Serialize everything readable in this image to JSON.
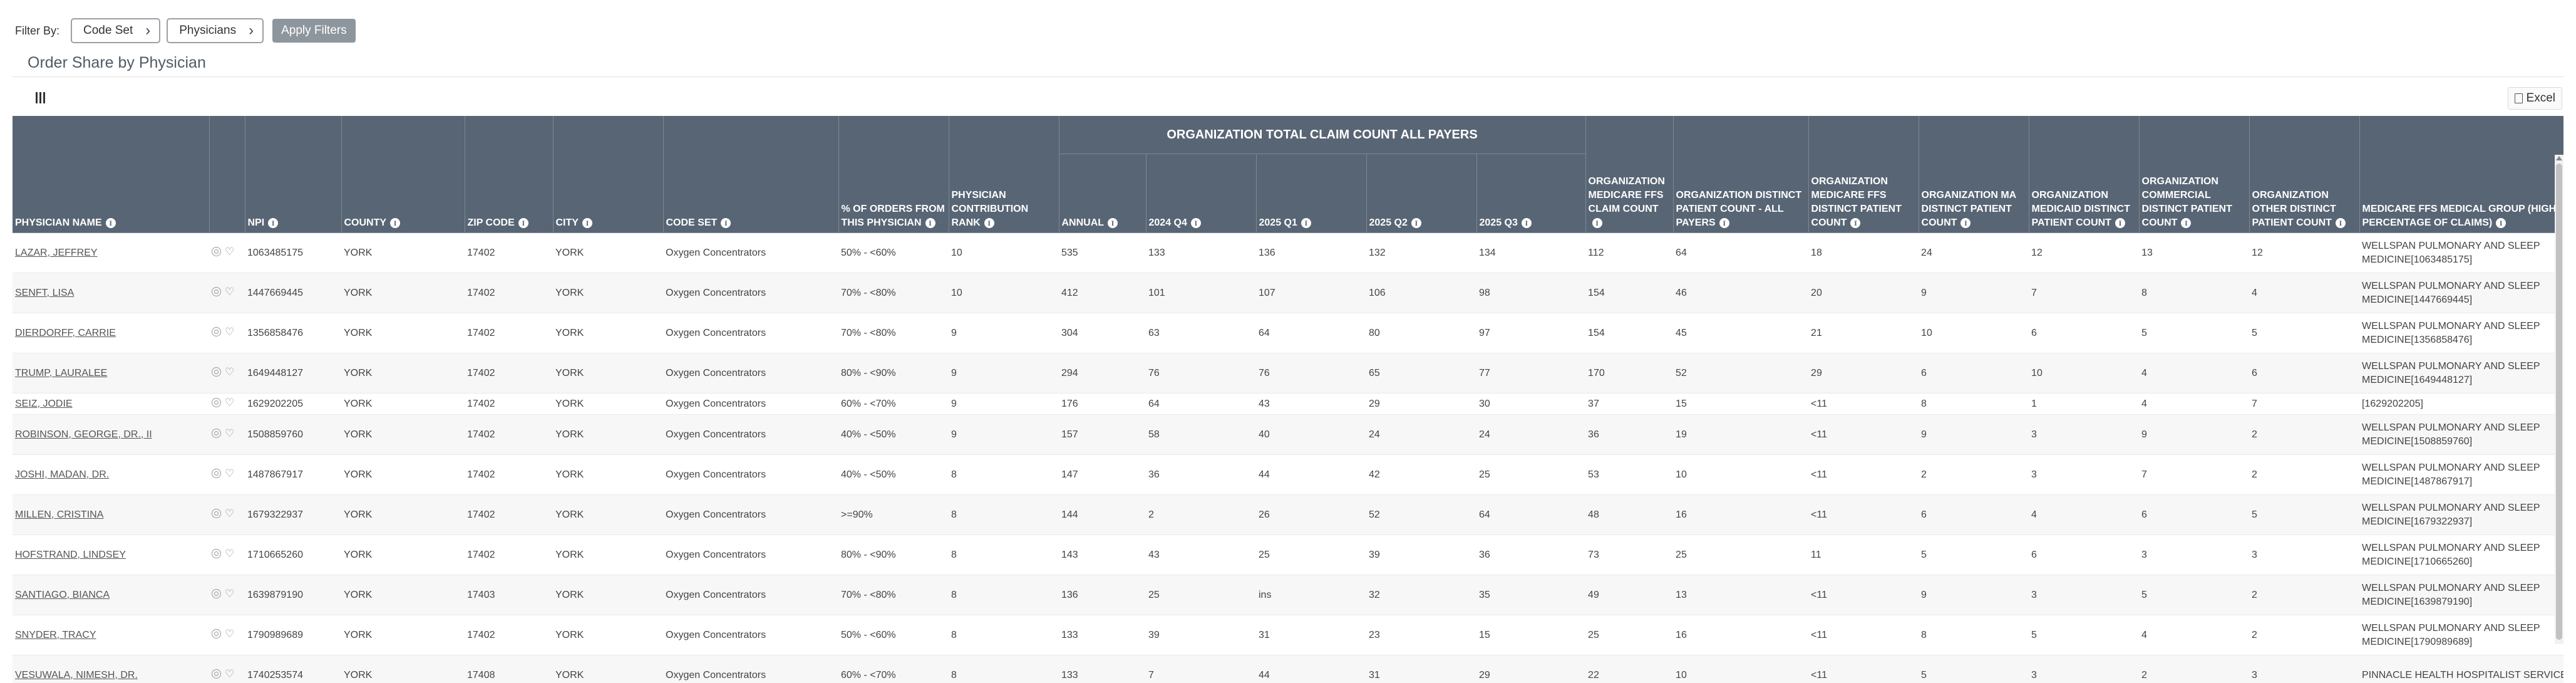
{
  "filter": {
    "label": "Filter By:",
    "code_set_label": "Code Set",
    "physicians_label": "Physicians",
    "apply_label": "Apply Filters"
  },
  "section": {
    "title": "Order Share by Physician"
  },
  "toolbar": {
    "columns_icon": "columns-icon",
    "excel_label": "Excel",
    "excel_icon": "document-icon"
  },
  "table": {
    "group_header": "ORGANIZATION TOTAL CLAIM COUNT ALL PAYERS",
    "headers": {
      "physician_name": "PHYSICIAN NAME",
      "npi": "NPI",
      "county": "COUNTY",
      "zip": "ZIP CODE",
      "city": "CITY",
      "code_set": "CODE SET",
      "pct": "% OF ORDERS FROM THIS PHYSICIAN",
      "rank": "PHYSICIAN CONTRIBUTION RANK",
      "annual": "ANNUAL",
      "q2024q4": "2024 Q4",
      "q2025q1": "2025 Q1",
      "q2025q2": "2025 Q2",
      "q2025q3": "2025 Q3",
      "medicare_ffs_claim": "ORGANIZATION MEDICARE FFS CLAIM COUNT",
      "distinct_all": "ORGANIZATION DISTINCT PATIENT COUNT - ALL PAYERS",
      "medicare_ffs_distinct": "ORGANIZATION MEDICARE FFS DISTINCT PATIENT COUNT",
      "ma_distinct": "ORGANIZATION MA DISTINCT PATIENT COUNT",
      "medicaid_distinct": "ORGANIZATION MEDICAID DISTINCT PATIENT COUNT",
      "commercial_distinct": "ORGANIZATION COMMERCIAL DISTINCT PATIENT COUNT",
      "other_distinct": "ORGANIZATION OTHER DISTINCT PATIENT COUNT",
      "medical_group": "MEDICARE FFS MEDICAL GROUP (HIGHEST PERCENTAGE OF CLAIMS)"
    },
    "rows": [
      {
        "name": "LAZAR, JEFFREY",
        "npi": "1063485175",
        "county": "YORK",
        "zip": "17402",
        "city": "YORK",
        "code_set": "Oxygen Concentrators",
        "pct": "50% - <60%",
        "rank": "10",
        "annual": "535",
        "q1": "133",
        "q2": "136",
        "q3": "132",
        "q4": "134",
        "mffs": "112",
        "dall": "64",
        "dmffs": "18",
        "dma": "24",
        "dmcd": "12",
        "dcom": "13",
        "doth": "12",
        "group": "WELLSPAN PULMONARY AND SLEEP MEDICINE[1063485175]"
      },
      {
        "name": "SENFT, LISA",
        "npi": "1447669445",
        "county": "YORK",
        "zip": "17402",
        "city": "YORK",
        "code_set": "Oxygen Concentrators",
        "pct": "70% - <80%",
        "rank": "10",
        "annual": "412",
        "q1": "101",
        "q2": "107",
        "q3": "106",
        "q4": "98",
        "mffs": "154",
        "dall": "46",
        "dmffs": "20",
        "dma": "9",
        "dmcd": "7",
        "dcom": "8",
        "doth": "4",
        "group": "WELLSPAN PULMONARY AND SLEEP MEDICINE[1447669445]"
      },
      {
        "name": "DIERDORFF, CARRIE",
        "npi": "1356858476",
        "county": "YORK",
        "zip": "17402",
        "city": "YORK",
        "code_set": "Oxygen Concentrators",
        "pct": "70% - <80%",
        "rank": "9",
        "annual": "304",
        "q1": "63",
        "q2": "64",
        "q3": "80",
        "q4": "97",
        "mffs": "154",
        "dall": "45",
        "dmffs": "21",
        "dma": "10",
        "dmcd": "6",
        "dcom": "5",
        "doth": "5",
        "group": "WELLSPAN PULMONARY AND SLEEP MEDICINE[1356858476]"
      },
      {
        "name": "TRUMP, LAURALEE",
        "npi": "1649448127",
        "county": "YORK",
        "zip": "17402",
        "city": "YORK",
        "code_set": "Oxygen Concentrators",
        "pct": "80% - <90%",
        "rank": "9",
        "annual": "294",
        "q1": "76",
        "q2": "76",
        "q3": "65",
        "q4": "77",
        "mffs": "170",
        "dall": "52",
        "dmffs": "29",
        "dma": "6",
        "dmcd": "10",
        "dcom": "4",
        "doth": "6",
        "group": "WELLSPAN PULMONARY AND SLEEP MEDICINE[1649448127]"
      },
      {
        "name": "SEIZ, JODIE",
        "npi": "1629202205",
        "county": "YORK",
        "zip": "17402",
        "city": "YORK",
        "code_set": "Oxygen Concentrators",
        "pct": "60% - <70%",
        "rank": "9",
        "annual": "176",
        "q1": "64",
        "q2": "43",
        "q3": "29",
        "q4": "30",
        "mffs": "37",
        "dall": "15",
        "dmffs": "<11",
        "dma": "8",
        "dmcd": "1",
        "dcom": "4",
        "doth": "7",
        "group": "[1629202205]"
      },
      {
        "name": "ROBINSON, GEORGE, DR., II",
        "npi": "1508859760",
        "county": "YORK",
        "zip": "17402",
        "city": "YORK",
        "code_set": "Oxygen Concentrators",
        "pct": "40% - <50%",
        "rank": "9",
        "annual": "157",
        "q1": "58",
        "q2": "40",
        "q3": "24",
        "q4": "24",
        "mffs": "36",
        "dall": "19",
        "dmffs": "<11",
        "dma": "9",
        "dmcd": "3",
        "dcom": "9",
        "doth": "2",
        "group": "WELLSPAN PULMONARY AND SLEEP MEDICINE[1508859760]"
      },
      {
        "name": "JOSHI, MADAN, DR.",
        "npi": "1487867917",
        "county": "YORK",
        "zip": "17402",
        "city": "YORK",
        "code_set": "Oxygen Concentrators",
        "pct": "40% - <50%",
        "rank": "8",
        "annual": "147",
        "q1": "36",
        "q2": "44",
        "q3": "42",
        "q4": "25",
        "mffs": "53",
        "dall": "10",
        "dmffs": "<11",
        "dma": "2",
        "dmcd": "3",
        "dcom": "7",
        "doth": "2",
        "group": "WELLSPAN PULMONARY AND SLEEP MEDICINE[1487867917]"
      },
      {
        "name": "MILLEN, CRISTINA",
        "npi": "1679322937",
        "county": "YORK",
        "zip": "17402",
        "city": "YORK",
        "code_set": "Oxygen Concentrators",
        "pct": ">=90%",
        "rank": "8",
        "annual": "144",
        "q1": "2",
        "q2": "26",
        "q3": "52",
        "q4": "64",
        "mffs": "48",
        "dall": "16",
        "dmffs": "<11",
        "dma": "6",
        "dmcd": "4",
        "dcom": "6",
        "doth": "5",
        "group": "WELLSPAN PULMONARY AND SLEEP MEDICINE[1679322937]"
      },
      {
        "name": "HOFSTRAND, LINDSEY",
        "npi": "1710665260",
        "county": "YORK",
        "zip": "17402",
        "city": "YORK",
        "code_set": "Oxygen Concentrators",
        "pct": "80% - <90%",
        "rank": "8",
        "annual": "143",
        "q1": "43",
        "q2": "25",
        "q3": "39",
        "q4": "36",
        "mffs": "73",
        "dall": "25",
        "dmffs": "11",
        "dma": "5",
        "dmcd": "6",
        "dcom": "3",
        "doth": "3",
        "group": "WELLSPAN PULMONARY AND SLEEP MEDICINE[1710665260]"
      },
      {
        "name": "SANTIAGO, BIANCA",
        "npi": "1639879190",
        "county": "YORK",
        "zip": "17403",
        "city": "YORK",
        "code_set": "Oxygen Concentrators",
        "pct": "70% - <80%",
        "rank": "8",
        "annual": "136",
        "q1": "25",
        "q2": "ins",
        "q3": "32",
        "q4": "35",
        "mffs": "49",
        "dall": "13",
        "dmffs": "<11",
        "dma": "9",
        "dmcd": "3",
        "dcom": "5",
        "doth": "2",
        "group": "WELLSPAN PULMONARY AND SLEEP MEDICINE[1639879190]"
      },
      {
        "name": "SNYDER, TRACY",
        "npi": "1790989689",
        "county": "YORK",
        "zip": "17402",
        "city": "YORK",
        "code_set": "Oxygen Concentrators",
        "pct": "50% - <60%",
        "rank": "8",
        "annual": "133",
        "q1": "39",
        "q2": "31",
        "q3": "23",
        "q4": "15",
        "mffs": "25",
        "dall": "16",
        "dmffs": "<11",
        "dma": "8",
        "dmcd": "5",
        "dcom": "4",
        "doth": "2",
        "group": "WELLSPAN PULMONARY AND SLEEP MEDICINE[1790989689]"
      },
      {
        "name": "VESUWALA, NIMESH, DR.",
        "npi": "1740253574",
        "county": "YORK",
        "zip": "17408",
        "city": "YORK",
        "code_set": "Oxygen Concentrators",
        "pct": "60% - <70%",
        "rank": "8",
        "annual": "133",
        "q1": "7",
        "q2": "44",
        "q3": "31",
        "q4": "29",
        "mffs": "22",
        "dall": "10",
        "dmffs": "<11",
        "dma": "5",
        "dmcd": "3",
        "dcom": "2",
        "doth": "3",
        "group": "PINNACLE HEALTH HOSPITALIST SERVICES"
      }
    ]
  }
}
